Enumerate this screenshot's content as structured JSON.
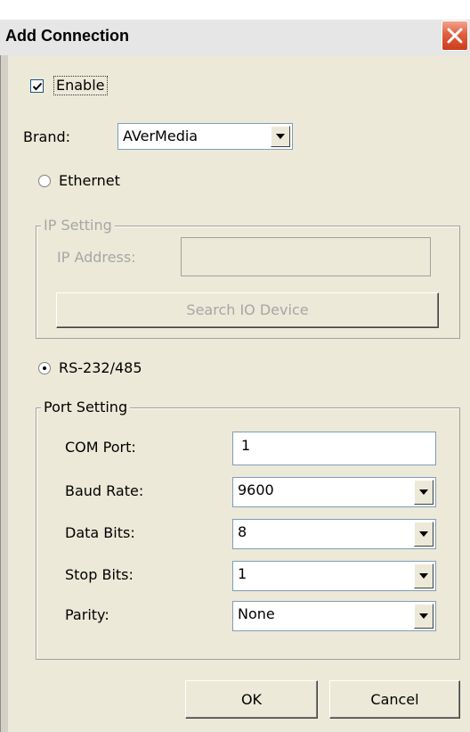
{
  "window": {
    "title": "Add Connection"
  },
  "enable": {
    "label": "Enable",
    "checked": true
  },
  "brand": {
    "label": "Brand:",
    "value": "AVerMedia"
  },
  "connection_type": {
    "ethernet_label": "Ethernet",
    "rs_label": "RS-232/485",
    "selected": "RS-232/485"
  },
  "ip_setting": {
    "legend": "IP Setting",
    "ip_address_label": "IP Address:",
    "ip_address_value": "",
    "search_button": "Search IO Device"
  },
  "port_setting": {
    "legend": "Port Setting",
    "com_port_label": "COM Port:",
    "com_port_value": "1",
    "baud_rate_label": "Baud Rate:",
    "baud_rate_value": "9600",
    "data_bits_label": "Data Bits:",
    "data_bits_value": "8",
    "stop_bits_label": "Stop Bits:",
    "stop_bits_value": "1",
    "parity_label": "Parity:",
    "parity_value": "None"
  },
  "buttons": {
    "ok": "OK",
    "cancel": "Cancel"
  },
  "colors": {
    "dialog_bg": "#ece9d8",
    "close_button": "#e05f3f",
    "field_border": "#7f9db9",
    "disabled_text": "#a6a6a6"
  }
}
